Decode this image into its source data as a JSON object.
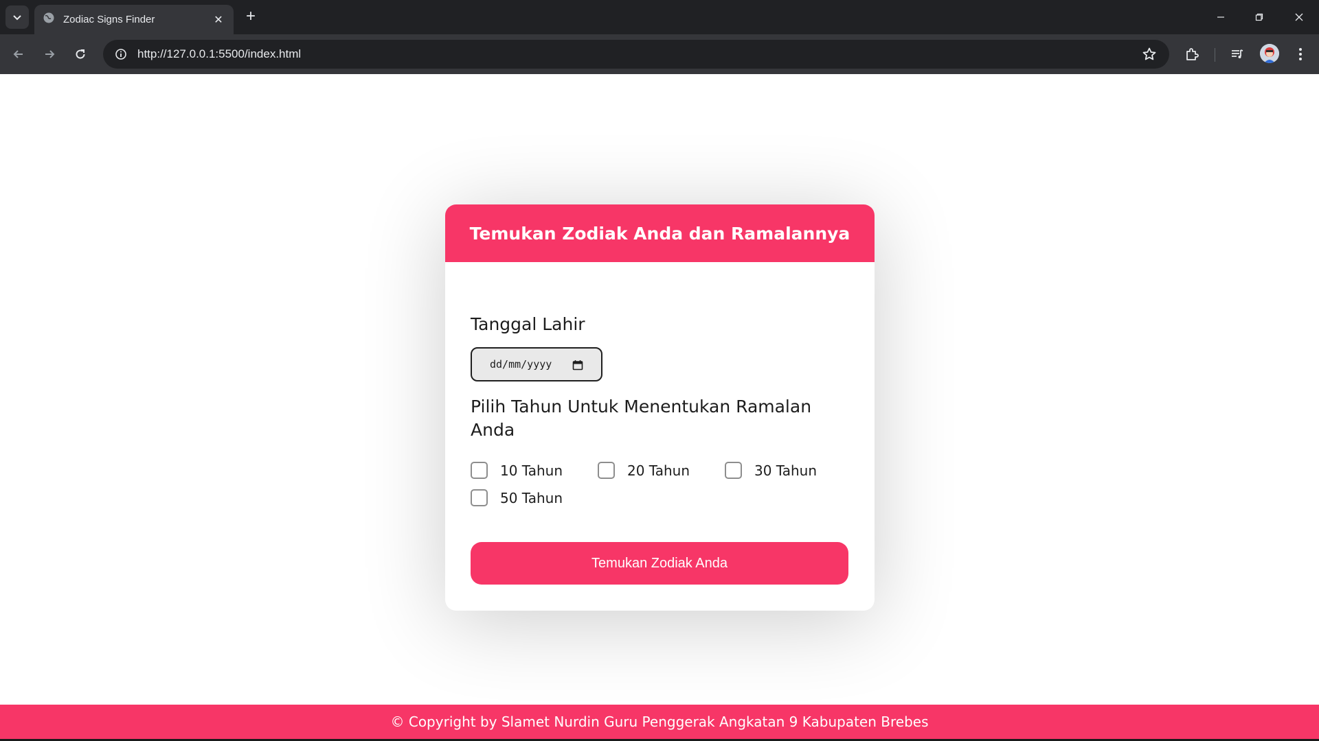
{
  "browser": {
    "tab_title": "Zodiac Signs Finder",
    "tab_close": "✕",
    "new_tab": "+",
    "url": "http://127.0.0.1:5500/index.html",
    "icons": [
      "tab-search-icon",
      "globe-icon",
      "back-icon",
      "forward-icon",
      "reload-icon",
      "info-icon",
      "star-icon",
      "extensions-icon",
      "media-control-icon",
      "profile-avatar",
      "more-menu-icon",
      "minimize-icon",
      "restore-icon",
      "close-window-icon"
    ]
  },
  "card": {
    "title": "Temukan Zodiak Anda dan Ramalannya",
    "date_label": "Tanggal Lahir",
    "date_placeholder": "dd/mm/yyyy",
    "year_label": "Pilih Tahun Untuk Menentukan Ramalan Anda",
    "options": [
      {
        "label": "10 Tahun",
        "checked": false
      },
      {
        "label": "20 Tahun",
        "checked": false
      },
      {
        "label": "30 Tahun",
        "checked": false
      },
      {
        "label": "50 Tahun",
        "checked": false
      }
    ],
    "submit_label": "Temukan Zodiak Anda"
  },
  "footer": {
    "text": "© Copyright by Slamet Nurdin Guru Penggerak Angkatan 9 Kabupaten Brebes"
  },
  "colors": {
    "accent": "#f73667",
    "chrome_dark": "#202124",
    "chrome_toolbar": "#35363a"
  }
}
